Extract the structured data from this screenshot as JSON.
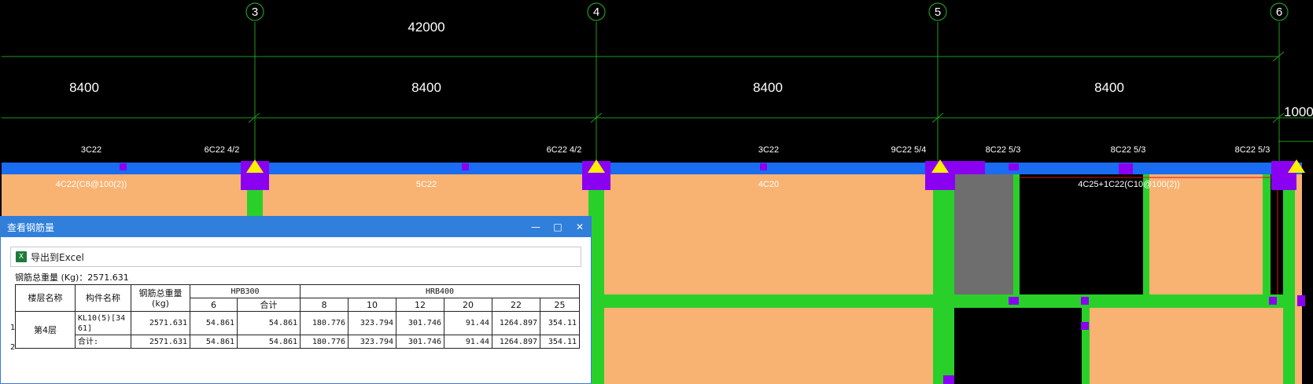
{
  "drawing": {
    "axes": [
      "3",
      "4",
      "5",
      "6"
    ],
    "total_dimension": "42000",
    "bay_dimensions": [
      "8400",
      "8400",
      "8400",
      "8400"
    ],
    "side_dimension": "1000",
    "top_rebar_labels": [
      "3C22",
      "6C22 4/2",
      "6C22 4/2",
      "3C22",
      "9C22 5/4",
      "8C22 5/3",
      "8C22 5/3",
      "8C22 5/3"
    ],
    "beam_labels": [
      "4C22(C8@100(2))",
      "5C22",
      "4C20",
      "4C25+1C22(C10@100(2))"
    ],
    "colors": {
      "axis_line": "#1f9a1f",
      "beam": "#1a6cf0",
      "slab": "#f8b272",
      "column": "#8a00f0",
      "wall": "#2ad02a",
      "marker": "#ffee00",
      "opening": "#6e6e6e"
    }
  },
  "dialog": {
    "title": "查看钢筋量",
    "minimize_icon": "minimize-icon",
    "maximize_icon": "maximize-icon",
    "close_icon": "close-icon",
    "export_label": "导出到Excel",
    "total_weight_text": "钢筋总重量 (Kg)：2571.631",
    "table": {
      "headers": {
        "floor": "楼层名称",
        "component": "构件名称",
        "total": "钢筋总重量\n(kg)",
        "hpb300": "HPB300",
        "hrb400": "HRB400",
        "hpb_cols": [
          "6",
          "合计"
        ],
        "hrb_cols": [
          "8",
          "10",
          "12",
          "20",
          "22",
          "25"
        ]
      },
      "row_numbers": [
        "1",
        "2"
      ],
      "floor_name": "第4层",
      "rows": [
        {
          "component": "KL10(5)[3461]",
          "total": "2571.631",
          "hpb6": "54.861",
          "hpb_sum": "54.861",
          "h8": "180.776",
          "h10": "323.794",
          "h12": "301.746",
          "h20": "91.44",
          "h22": "1264.897",
          "h25": "354.11"
        },
        {
          "component": "合计:",
          "total": "2571.631",
          "hpb6": "54.861",
          "hpb_sum": "54.861",
          "h8": "180.776",
          "h10": "323.794",
          "h12": "301.746",
          "h20": "91.44",
          "h22": "1264.897",
          "h25": "354.11"
        }
      ]
    }
  }
}
